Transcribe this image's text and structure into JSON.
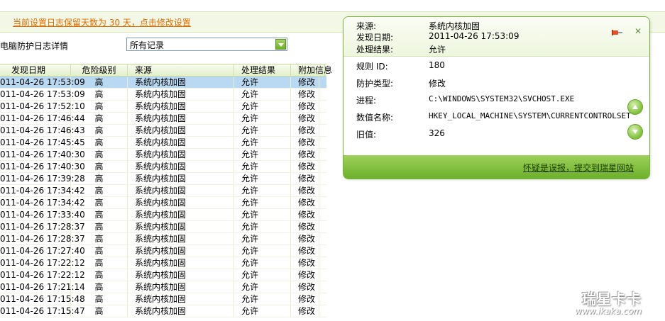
{
  "notice": "当前设置日志保留天数为 30 天，点击修改设置",
  "filter": {
    "label": "电脑防护日志详情",
    "selected": "所有记录"
  },
  "columns": [
    "发现日期",
    "危险级别",
    "来源",
    "处理结果",
    "附加信息"
  ],
  "rows": [
    [
      "011-04-26 17:53:09",
      "高",
      "系统内核加固",
      "允许",
      "修改"
    ],
    [
      "011-04-26 17:53:09",
      "高",
      "系统内核加固",
      "允许",
      "修改"
    ],
    [
      "011-04-26 17:52:10",
      "高",
      "系统内核加固",
      "允许",
      "修改"
    ],
    [
      "011-04-26 17:46:44",
      "高",
      "系统内核加固",
      "允许",
      "修改"
    ],
    [
      "011-04-26 17:46:43",
      "高",
      "系统内核加固",
      "允许",
      "修改"
    ],
    [
      "011-04-26 17:45:45",
      "高",
      "系统内核加固",
      "允许",
      "修改"
    ],
    [
      "011-04-26 17:40:30",
      "高",
      "系统内核加固",
      "允许",
      "修改"
    ],
    [
      "011-04-26 17:40:30",
      "高",
      "系统内核加固",
      "允许",
      "修改"
    ],
    [
      "011-04-26 17:39:28",
      "高",
      "系统内核加固",
      "允许",
      "修改"
    ],
    [
      "011-04-26 17:34:42",
      "高",
      "系统内核加固",
      "允许",
      "修改"
    ],
    [
      "011-04-26 17:34:42",
      "高",
      "系统内核加固",
      "允许",
      "修改"
    ],
    [
      "011-04-26 17:33:40",
      "高",
      "系统内核加固",
      "允许",
      "修改"
    ],
    [
      "011-04-26 17:28:37",
      "高",
      "系统内核加固",
      "允许",
      "修改"
    ],
    [
      "011-04-26 17:28:37",
      "高",
      "系统内核加固",
      "允许",
      "修改"
    ],
    [
      "011-04-26 17:27:40",
      "高",
      "系统内核加固",
      "允许",
      "修改"
    ],
    [
      "011-04-26 17:22:12",
      "高",
      "系统内核加固",
      "允许",
      "修改"
    ],
    [
      "011-04-26 17:22:12",
      "高",
      "系统内核加固",
      "允许",
      "修改"
    ],
    [
      "011-04-26 17:21:14",
      "高",
      "系统内核加固",
      "允许",
      "修改"
    ],
    [
      "011-04-26 17:15:48",
      "高",
      "系统内核加固",
      "允许",
      "修改"
    ],
    [
      "011-04-26 17:15:47",
      "高",
      "系统内核加固",
      "允许",
      "修改"
    ]
  ],
  "popup": {
    "source_label": "来源:",
    "source": "系统内核加固",
    "date_label": "发现日期:",
    "date": "2011-04-26 17:53:09",
    "result_label": "处理结果:",
    "result": "允许",
    "rule_label": "规则 ID:",
    "rule": "180",
    "type_label": "防护类型:",
    "type": "修改",
    "process_label": "进程:",
    "process": "C:\\WINDOWS\\SYSTEM32\\SVCHOST.EXE",
    "valname_label": "数值名称:",
    "valname": "HKEY_LOCAL_MACHINE\\SYSTEM\\CURRENTCONTROLSET",
    "old_label": "旧值:",
    "old": "326",
    "report": "怀疑是误报，提交到瑞星网站"
  },
  "watermark": {
    "brand": "瑞星卡卡",
    "site": "www.ikaka.com"
  },
  "colors": {
    "accent": "#6cb02a",
    "notice": "#e26b00",
    "selected_row": "#b9d8f1"
  }
}
